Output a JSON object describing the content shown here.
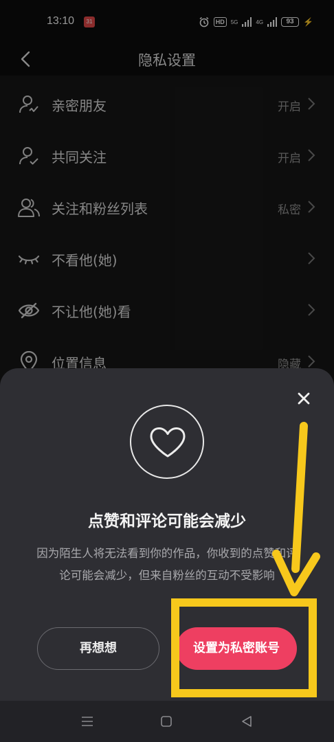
{
  "status_bar": {
    "time": "13:10",
    "notification_badge": "31",
    "icons": [
      "alarm-icon",
      "hd-icon",
      "signal-icon",
      "signal-icon"
    ],
    "hd_label": "HD",
    "net1_label": "5G",
    "net2_label": "4G",
    "battery": "93",
    "charging": true
  },
  "header": {
    "title": "隐私设置",
    "back_icon": "back-arrow-icon"
  },
  "settings": {
    "items": [
      {
        "label": "亲密朋友",
        "value": "开启",
        "icon": "close-friend-icon"
      },
      {
        "label": "共同关注",
        "value": "开启",
        "icon": "mutual-follow-icon"
      },
      {
        "label": "关注和粉丝列表",
        "value": "私密",
        "icon": "users-icon"
      },
      {
        "label": "不看他(她)",
        "value": "",
        "icon": "closed-eye-icon"
      },
      {
        "label": "不让他(她)看",
        "value": "",
        "icon": "eye-off-icon"
      },
      {
        "label": "位置信息",
        "value": "隐藏",
        "icon": "location-pin-icon"
      }
    ]
  },
  "dialog": {
    "icon": "heart-icon",
    "title": "点赞和评论可能会减少",
    "description": "因为陌生人将无法看到你的作品，你收到的点赞和评论可能会减少，但来自粉丝的互动不受影响",
    "cancel_label": "再想想",
    "confirm_label": "设置为私密账号",
    "close_icon": "close-icon"
  },
  "nav_bar": {
    "icons": [
      "menu-icon",
      "home-icon",
      "back-icon"
    ]
  },
  "colors": {
    "background": "#161616",
    "sheet": "#2e2e33",
    "accent": "#ee3f61",
    "annotation": "#f7c81c"
  }
}
